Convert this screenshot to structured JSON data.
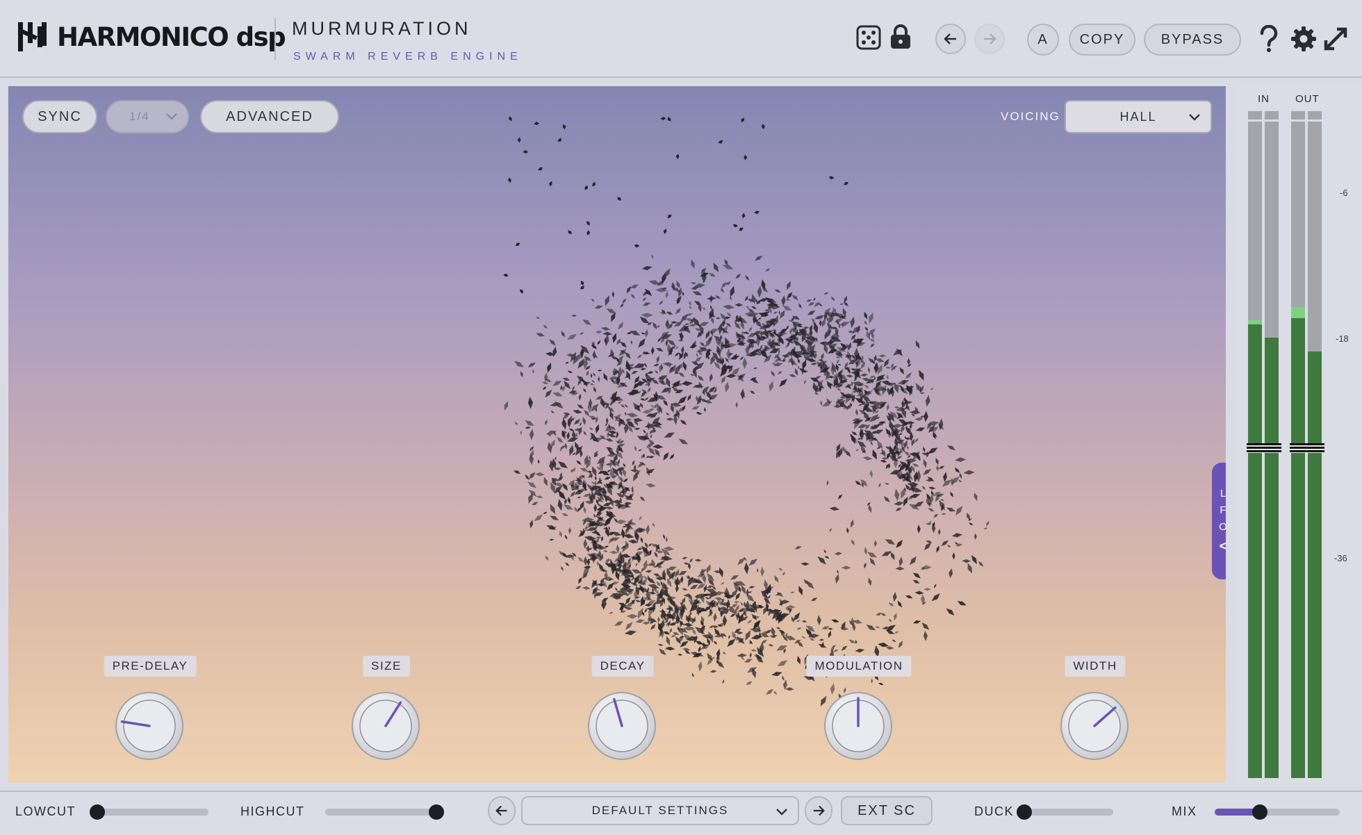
{
  "header": {
    "brand": "HARMONICO dsp",
    "plugin_name": "MURMURATION",
    "plugin_subtitle": "SWARM REVERB ENGINE",
    "ab_label": "A",
    "copy_label": "COPY",
    "bypass_label": "BYPASS"
  },
  "controls": {
    "sync_label": "SYNC",
    "sync_division": "1/4",
    "advanced_label": "ADVANCED",
    "voicing_label": "VOICING",
    "voicing_value": "HALL"
  },
  "knobs": [
    {
      "label": "PRE-DELAY",
      "value": 0.2
    },
    {
      "label": "SIZE",
      "value": 0.62
    },
    {
      "label": "DECAY",
      "value": 0.44
    },
    {
      "label": "MODULATION",
      "value": 0.5
    },
    {
      "label": "WIDTH",
      "value": 0.68
    }
  ],
  "lfo_tab": {
    "letters": [
      "L",
      "F",
      "O"
    ],
    "arrow": "<"
  },
  "meters": {
    "in_label": "IN",
    "out_label": "OUT",
    "scale": [
      "-6",
      "-18",
      "-36"
    ],
    "in_levels": [
      0.68,
      0.66
    ],
    "out_levels": [
      0.69,
      0.64
    ]
  },
  "footer": {
    "lowcut_label": "LOWCUT",
    "lowcut_value": 0.0,
    "highcut_label": "HIGHCUT",
    "highcut_value": 1.0,
    "preset_name": "DEFAULT SETTINGS",
    "ext_sc_label": "EXT SC",
    "duck_label": "DUCK",
    "duck_value": 0.0,
    "mix_label": "MIX",
    "mix_value": 0.36
  },
  "colors": {
    "accent": "#6a54b4",
    "meter_green": "#3e7a3e",
    "meter_peak": "#7ed27e",
    "meter_bg": "#a3a5ab"
  }
}
